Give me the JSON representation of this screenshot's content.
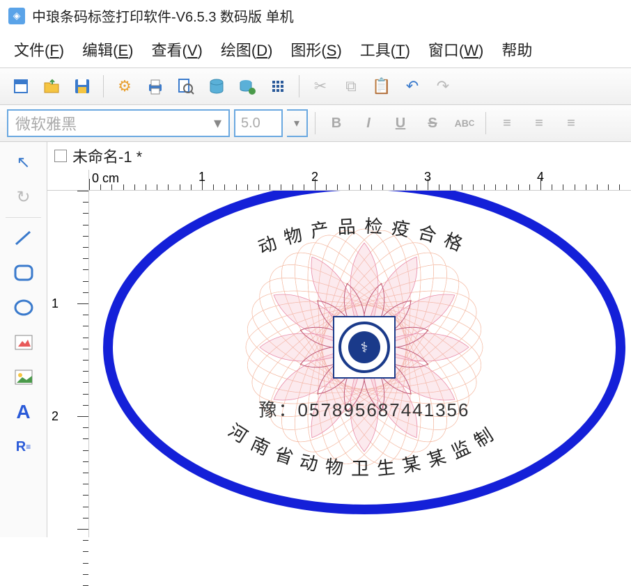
{
  "title": "中琅条码标签打印软件-V6.5.3 数码版 单机",
  "menu": {
    "file": "文件",
    "file_k": "F",
    "edit": "编辑",
    "edit_k": "E",
    "view": "查看",
    "view_k": "V",
    "draw": "绘图",
    "draw_k": "D",
    "shape": "图形",
    "shape_k": "S",
    "tool": "工具",
    "tool_k": "T",
    "window": "窗口",
    "window_k": "W",
    "help": "帮助"
  },
  "format": {
    "font_placeholder": "微软雅黑",
    "size_value": "5.0"
  },
  "document": {
    "tab_label": "未命名-1 *"
  },
  "ruler": {
    "unit_label": "0 cm",
    "h_marks": [
      "1",
      "2",
      "3",
      "4"
    ],
    "v_marks": [
      "1",
      "2"
    ]
  },
  "label": {
    "top_arc_text": "动物产品检疫合格",
    "bottom_arc_text": "河南省动物卫生某某监制",
    "serial_prefix": "豫：",
    "serial_number": "057895687441356",
    "ellipse_color": "#1420d8"
  }
}
